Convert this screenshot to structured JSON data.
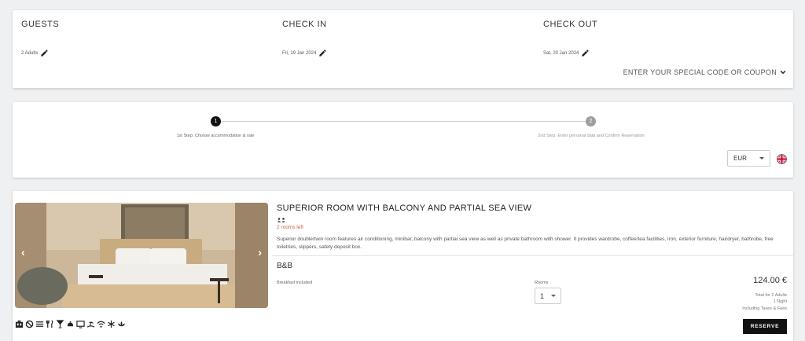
{
  "search": {
    "guests_label": "GUESTS",
    "guests_value": "2 Adults",
    "checkin_label": "CHECK IN",
    "checkin_value": "Fri, 19 Jan 2024",
    "checkout_label": "CHECK OUT",
    "checkout_value": "Sat, 20 Jan 2024",
    "coupon_label": "ENTER YOUR SPECIAL CODE OR COUPON"
  },
  "steps": {
    "step1_number": "1",
    "step1_label": "1st Step: Choose accommodation & rate",
    "step2_number": "2",
    "step2_label": "2nd Step: Enter personal data and Confirm Reservation"
  },
  "currency": {
    "selected": "EUR"
  },
  "room": {
    "title": "SUPERIOR ROOM WITH BALCONY AND PARTIAL SEA VIEW",
    "rooms_left": "2 rooms left",
    "description": "Superior double/twin room features air conditioning, minibar, balcony with partial sea view as well as private bathroom with shower. It provides wardrobe, coffee/tea facilities, iron, exterior furniture, hairdryer, bathrobe, free toiletries, slippers, safety deposit box.",
    "amenity_icons": [
      "minibar-icon",
      "no-smoking-icon",
      "air-conditioning-icon",
      "restaurant-icon",
      "bar-icon",
      "room-service-icon",
      "tv-icon",
      "beach-icon",
      "wifi-icon",
      "snowflake-icon",
      "spa-icon"
    ]
  },
  "rate": {
    "name": "B&B",
    "board": "Breakfast included",
    "rooms_label": "Rooms",
    "rooms_value": "1",
    "price": "124.00 €",
    "total_for": "Total for 2 Adults",
    "nights": "1 Night",
    "taxes": "Including Taxes & Fees",
    "reserve_label": "RESERVE"
  },
  "colors": {
    "accent": "#111111",
    "rooms_left": "#d05a45",
    "background": "#eef0f2"
  }
}
